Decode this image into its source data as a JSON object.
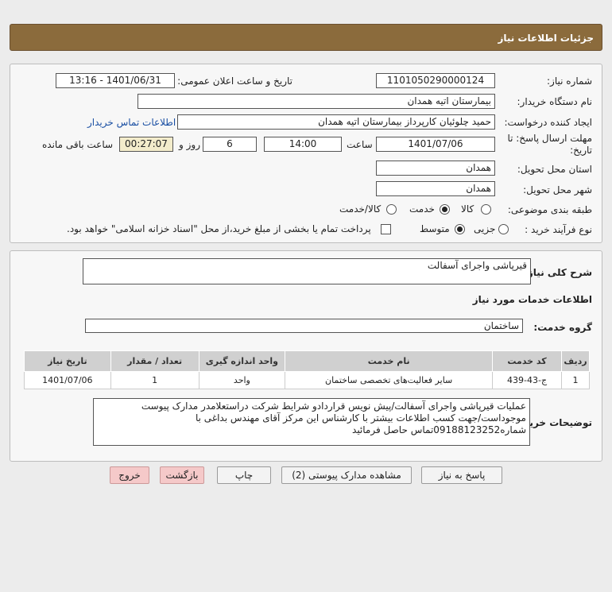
{
  "header": {
    "title": "جزئیات اطلاعات نیاز"
  },
  "form": {
    "need_number_label": "شماره نیاز:",
    "need_number": "1101050290000124",
    "announce_label": "تاریخ و ساعت اعلان عمومی:",
    "announce_value": "1401/06/31 - 13:16",
    "buyer_org_label": "نام دستگاه خریدار:",
    "buyer_org": "بیمارستان اتیه همدان",
    "requester_label": "ایجاد کننده درخواست:",
    "requester": "حمید چلوئیان  کارپرداز بیمارستان اتیه همدان",
    "contact_link": "اطلاعات تماس خریدار",
    "deadline_label_1": "مهلت ارسال پاسخ: تا",
    "deadline_label_2": "تاریخ:",
    "deadline_date": "1401/07/06",
    "time_label": "ساعت",
    "deadline_time": "14:00",
    "days_value": "6",
    "days_label": "روز و",
    "remaining_time": "00:27:07",
    "remaining_label": "ساعت باقی مانده",
    "province_label": "استان محل تحویل:",
    "province": "همدان",
    "city_label": "شهر محل تحویل:",
    "city": "همدان",
    "category_label": "طبقه بندی موضوعی:",
    "category_options": {
      "goods": "کالا",
      "service": "خدمت",
      "goods_service": "کالا/خدمت"
    },
    "category_selected": "خدمت",
    "purchase_type_label": "نوع فرآیند خرید :",
    "purchase_options": {
      "partial": "جزیی",
      "medium": "متوسط"
    },
    "purchase_selected": "متوسط",
    "treasury_note": "پرداخت تمام یا بخشی از مبلغ خرید،از محل \"اسناد خزانه اسلامی\" خواهد بود."
  },
  "details": {
    "summary_label": "شرح کلی نیاز:",
    "summary": "قیرپاشی واجرای آسفالت",
    "services_title": "اطلاعات خدمات مورد نیاز",
    "service_group_label": "گروه خدمت:",
    "service_group": "ساختمان",
    "table": {
      "headers": [
        "ردیف",
        "کد خدمت",
        "نام خدمت",
        "واحد اندازه گیری",
        "تعداد / مقدار",
        "تاریخ نیاز"
      ],
      "rows": [
        [
          "1",
          "ج-43-439",
          "سایر فعالیت‌های تخصصی ساختمان",
          "واحد",
          "1",
          "1401/07/06"
        ]
      ]
    },
    "buyer_notes_label": "توضیحات خریدار:",
    "buyer_notes": "عملیات قیرپاشی واجرای آسفالت/پیش نویس قراردادو شرایط شرکت دراستعلامدر مدارک پیوست موجوداست/جهت کسب اطلاعات بیشتر با کارشناس این مرکز آقای مهندس بداغی با شماره09188123252تماس حاصل فرمائید"
  },
  "buttons": {
    "reply": "پاسخ به نیاز",
    "view_docs": "مشاهده مدارک پیوستی (2)",
    "print": "چاپ",
    "back": "بازگشت",
    "exit": "خروج"
  },
  "colors": {
    "header_bg": "#8b6b3c",
    "link": "#1a4fa3",
    "pink_button": "#f5c9c9"
  }
}
